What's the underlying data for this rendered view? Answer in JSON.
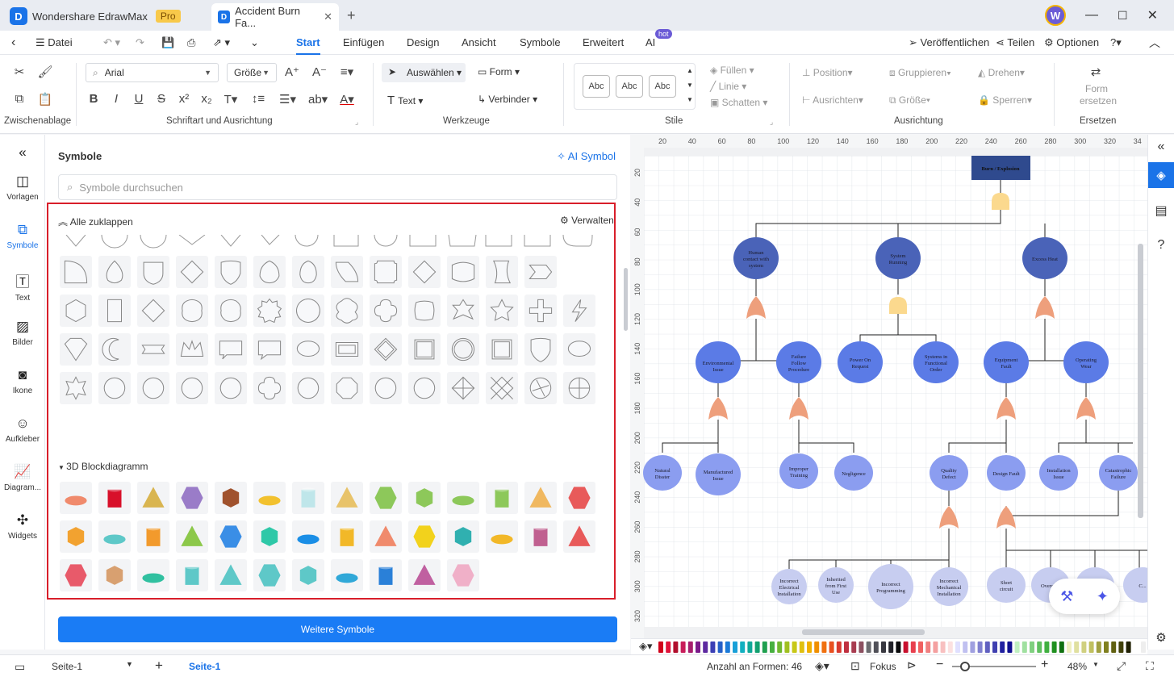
{
  "app": {
    "name": "Wondershare EdrawMax",
    "badge": "Pro",
    "doc_tab": "Accident Burn Fa...",
    "avatar": "W"
  },
  "menu": {
    "file": "Datei",
    "tabs": [
      "Start",
      "Einfügen",
      "Design",
      "Ansicht",
      "Symbole",
      "Erweitert",
      "AI"
    ],
    "ai_badge": "hot",
    "publish": "Veröffentlichen",
    "share": "Teilen",
    "options": "Optionen"
  },
  "ribbon": {
    "font": "Arial",
    "size": "Größe",
    "groups": [
      "Zwischenablage",
      "Schriftart und Ausrichtung",
      "Werkzeuge",
      "Stile",
      "Ausrichtung",
      "Ersetzen"
    ],
    "select": "Auswählen",
    "shape": "Form",
    "text": "Text",
    "connector": "Verbinder",
    "style_sample": "Abc",
    "fill": "Füllen",
    "line": "Linie",
    "shadow": "Schatten",
    "position": "Position",
    "group": "Gruppieren",
    "rotate": "Drehen",
    "align": "Ausrichten",
    "lock": "Sperren",
    "replace": "Form ersetzen"
  },
  "leftnav": [
    "Vorlagen",
    "Symbole",
    "Text",
    "Bilder",
    "Ikone",
    "Aufkleber",
    "Diagram...",
    "Widgets"
  ],
  "panel": {
    "title": "Symbole",
    "ai_symbol": "AI Symbol",
    "search_placeholder": "Symbole durchsuchen",
    "collapse_all": "Alle zuklappen",
    "manage": "Verwalten",
    "section_3d": "3D Blockdiagramm",
    "more_symbols": "Weitere Symbole"
  },
  "ruler": {
    "top": [
      "20",
      "40",
      "60",
      "80",
      "100",
      "120",
      "140",
      "160",
      "180",
      "200",
      "220",
      "240",
      "260",
      "280",
      "300",
      "320",
      "34"
    ],
    "left": [
      "20",
      "40",
      "60",
      "80",
      "100",
      "120",
      "140",
      "160",
      "180",
      "200",
      "220",
      "240",
      "260",
      "280",
      "300",
      "320"
    ]
  },
  "diagram": {
    "top_event": "Burn / Explosion",
    "level1": [
      "Human contact with system",
      "System Running",
      "Excess Heat"
    ],
    "level2": [
      "Environmental Issue",
      "Failure Follow Procedure",
      "Power On Request",
      "Systems in Functional Order",
      "Equipment Fault",
      "Operating Wear"
    ],
    "level3": [
      "Natural Disster",
      "Manufactured Issue",
      "Improper Training",
      "Negligence",
      "Quality Defect",
      "Design Fault",
      "Installation Issue",
      "Catastrophic Failure"
    ],
    "level4": [
      "Incorrect Electrical Installation",
      "Inherited from First Use",
      "Incorrect Programming",
      "Incorrect Mechanical Installation",
      "Short circuit",
      "Overch...",
      "Thermal...",
      "C..."
    ]
  },
  "status": {
    "page_select": "Seite-1",
    "page_tab": "Seite-1",
    "shapes_count": "Anzahl an Formen: 46",
    "focus": "Fokus",
    "zoom": "48%"
  },
  "colors": {
    "accent": "#1a73e8",
    "highlight": "#d81e2a",
    "node_dark": "#4a63b8",
    "node_mid": "#5b7be6",
    "node_light": "#8b9df0",
    "node_pale": "#c7cdf0",
    "gate_or": "#ee9f7c",
    "gate_and": "#fbd98e"
  }
}
